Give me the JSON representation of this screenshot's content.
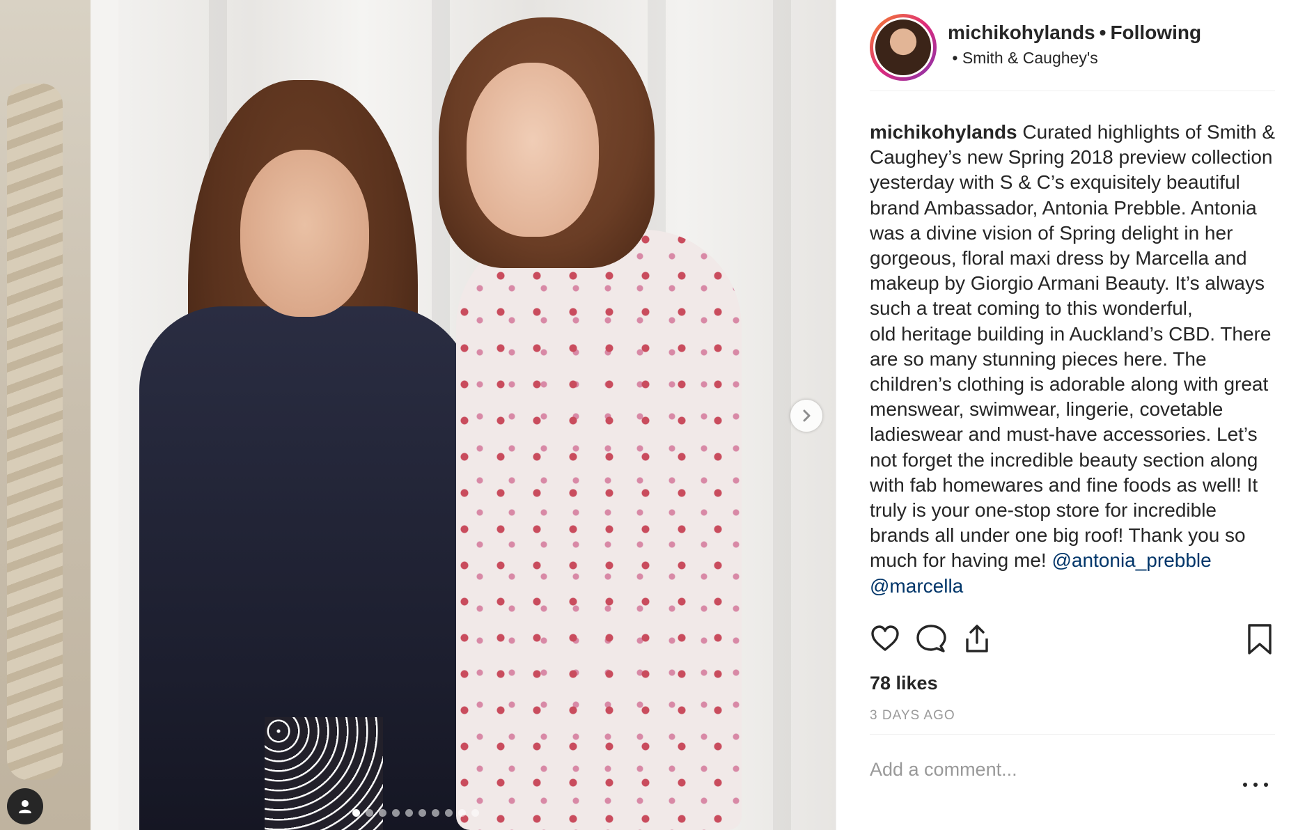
{
  "header": {
    "username": "michikohylands",
    "separator": "•",
    "follow_label": "Following",
    "location_prefix": "•",
    "location": "Smith & Caughey's"
  },
  "caption": {
    "username": "michikohylands",
    "text_before": "Curated highlights of Smith & Caughey’s new Spring 2018 preview collection yesterday with S & C’s exquisitely beautiful brand Ambassador, Antonia Prebble. Antonia was a divine vision of Spring delight in her gorgeous, floral maxi dress by Marcella and makeup by Giorgio Armani Beauty. It’s always such a treat coming to this wonderful,",
    "text_line2": "old heritage building in Auckland’s CBD. There are so many stunning pieces here. The children’s clothing is adorable along with great menswear, swimwear, lingerie, covetable ladieswear and must-have accessories. Let’s not forget the incredible beauty section along with fab homewares and fine foods as well! It truly is your one-stop store for incredible brands all under one big roof! Thank you so much for having me!",
    "mention_1": "@antonia_prebble",
    "mention_2": "@marcella"
  },
  "stats": {
    "likes": "78 likes",
    "timestamp": "3 DAYS AGO"
  },
  "comment": {
    "placeholder": "Add a comment..."
  },
  "carousel": {
    "total_slides": 10,
    "active_slide": 1
  },
  "icons": {
    "like": "heart-icon",
    "comment": "comment-icon",
    "share": "share-icon",
    "save": "bookmark-icon",
    "next": "chevron-right-icon",
    "tag": "user-tag-icon",
    "more": "more-options-icon"
  },
  "colors": {
    "text": "#262626",
    "muted": "#999999",
    "link": "#003569",
    "border": "#efefef"
  }
}
